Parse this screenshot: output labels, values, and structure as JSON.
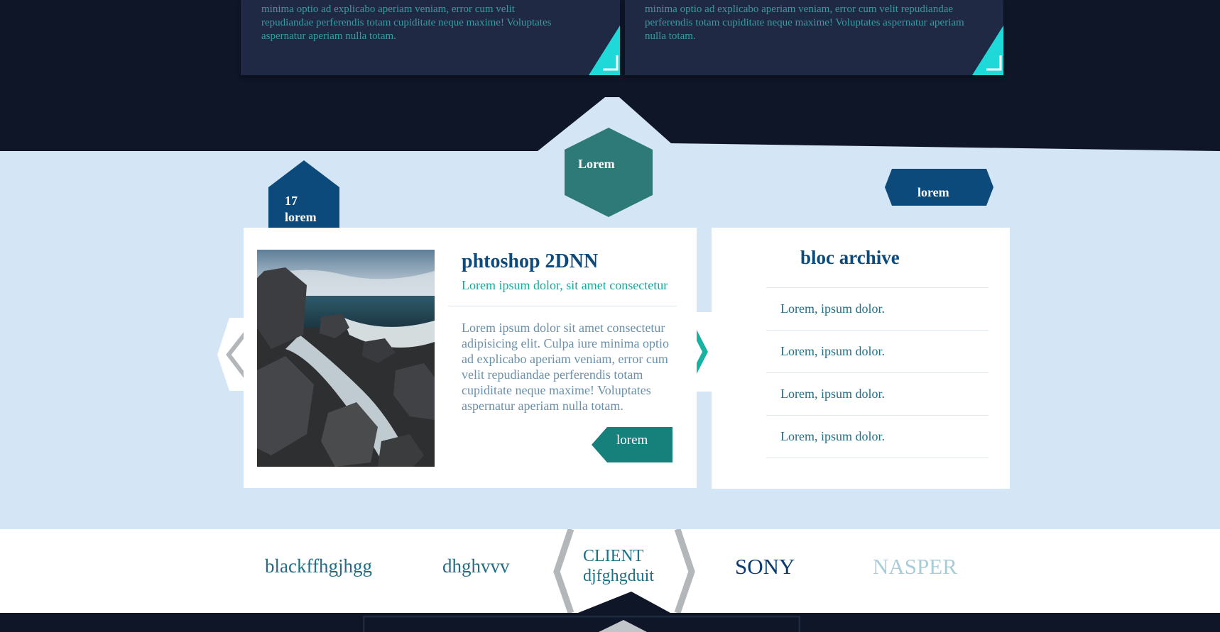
{
  "top_cards": [
    {
      "text": "minima optio ad explicabo aperiam veniam, error cum velit repudiandae perferendis totam cupiditate neque maxime! Voluptates aspernatur aperiam nulla totam."
    },
    {
      "text": "minima optio ad explicabo aperiam veniam, error cum velit repudiandae perferendis totam cupiditate neque maxime! Voluptates aspernatur aperiam nulla totam."
    }
  ],
  "center_hex_label": "Lorem",
  "date_badge": {
    "day": "17",
    "label": "lorem"
  },
  "right_tag_label": "lorem",
  "post": {
    "title": "phtoshop 2DNN",
    "subtitle": "Lorem ipsum dolor, sit amet consectetur",
    "body": "Lorem ipsum dolor sit amet consectetur adipisicing elit. Culpa iure minima optio ad explicabo aperiam veniam, error cum velit repudiandae perferendis totam cupiditate neque maxime! Voluptates aspernatur aperiam nulla totam.",
    "button_label": "lorem"
  },
  "archive": {
    "title": "bloc archive",
    "items": [
      "Lorem, ipsum dolor.",
      "Lorem, ipsum dolor.",
      "Lorem, ipsum dolor.",
      "Lorem, ipsum dolor."
    ]
  },
  "clients": [
    {
      "name": "blackffhgjhgg",
      "color": "#1f6f86"
    },
    {
      "name": "dhghvvv",
      "color": "#1f6f86"
    },
    {
      "name_line1": "CLIENT",
      "name_line2": "djfghgduit",
      "color": "#1f6f86"
    },
    {
      "name": "SONY",
      "color": "#0d3a6e"
    },
    {
      "name": "NASPER",
      "color": "#a9cdd8"
    }
  ],
  "colors": {
    "dark_bg": "#0e1628",
    "light_band": "#d4e6f6",
    "navy": "#0d4a7c",
    "teal": "#16807b",
    "cyan_accent": "#1fd8d8",
    "hex_teal": "#2e7a78"
  }
}
